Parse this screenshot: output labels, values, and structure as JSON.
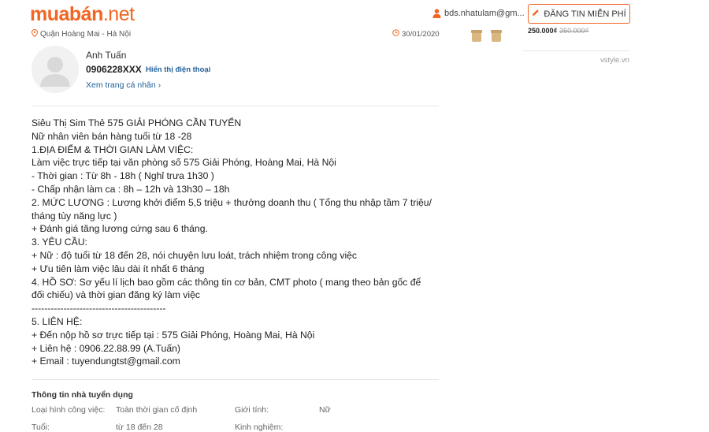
{
  "header": {
    "logo_part1": "muabán",
    "logo_part2": ".net",
    "user_email": "bds.nhatulam@gm...",
    "post_button": "ĐĂNG TIN MIỄN PHÍ"
  },
  "listing_meta": {
    "location": "Quận Hoàng Mai - Hà Nội",
    "date": "30/01/2020"
  },
  "sidebar_ad": {
    "price": "250.000₫",
    "old_price": "350.000₫",
    "source": "vstyle.vn"
  },
  "seller": {
    "name": "Anh Tuấn",
    "phone": "0906228XXX",
    "show_phone_label": "Hiển thị điện thoại",
    "profile_link": "Xem trang cá nhân"
  },
  "description": [
    "Siêu Thị Sim Thẻ 575 GIẢI PHÓNG CẦN TUYỂN",
    "Nữ nhân viên bán hàng tuổi từ 18 -28",
    "1.ĐỊA ĐIỂM & THỜI GIAN LÀM VIỆC:",
    "Làm việc trực tiếp tại văn phòng số 575 Giải Phóng, Hoàng Mai, Hà Nội",
    "- Thời gian : Từ 8h - 18h ( Nghỉ trưa 1h30 )",
    "- Chấp nhận làm ca : 8h – 12h và 13h30 – 18h",
    "2. MỨC LƯƠNG : Lương khởi điểm 5,5 triệu + thưởng doanh thu ( Tổng thu nhập tầm 7 triệu/",
    "tháng tùy năng lực )",
    "+ Đánh giá tăng lương cứng sau 6 tháng.",
    "3. YÊU CẦU:",
    "+ Nữ : độ tuổi từ 18 đến 28, nói chuyện lưu loát, trách nhiệm trong công việc",
    "+ Ưu tiên làm việc lâu dài ít nhất 6 tháng",
    "4. HỒ SƠ: Sơ yếu lí lịch bao gồm các thông tin cơ bản, CMT photo ( mang theo bản gốc để",
    "đối chiếu) và thời gian đăng ký làm việc",
    "------------------------------------------",
    "5. LIÊN HỆ:",
    "+ Đến nộp hồ sơ trực tiếp tại : 575 Giải Phóng, Hoàng Mai, Hà Nội",
    "+ Liên hệ : 0906.22.88.99 (A.Tuấn)",
    "+ Email : tuyendungtst@gmail.com"
  ],
  "employer_info": {
    "title": "Thông tin nhà tuyển dụng",
    "rows": [
      {
        "label1": "Loại hình công việc:",
        "value1": "Toàn thời gian cố định",
        "label2": "Giới tính:",
        "value2": "Nữ"
      },
      {
        "label1": "Tuổi:",
        "value1": "từ 18 đến 28",
        "label2": "Kinh nghiệm:",
        "value2": ""
      }
    ]
  },
  "colors": {
    "brand_orange": "#f26522",
    "link_blue": "#1f5f99"
  }
}
